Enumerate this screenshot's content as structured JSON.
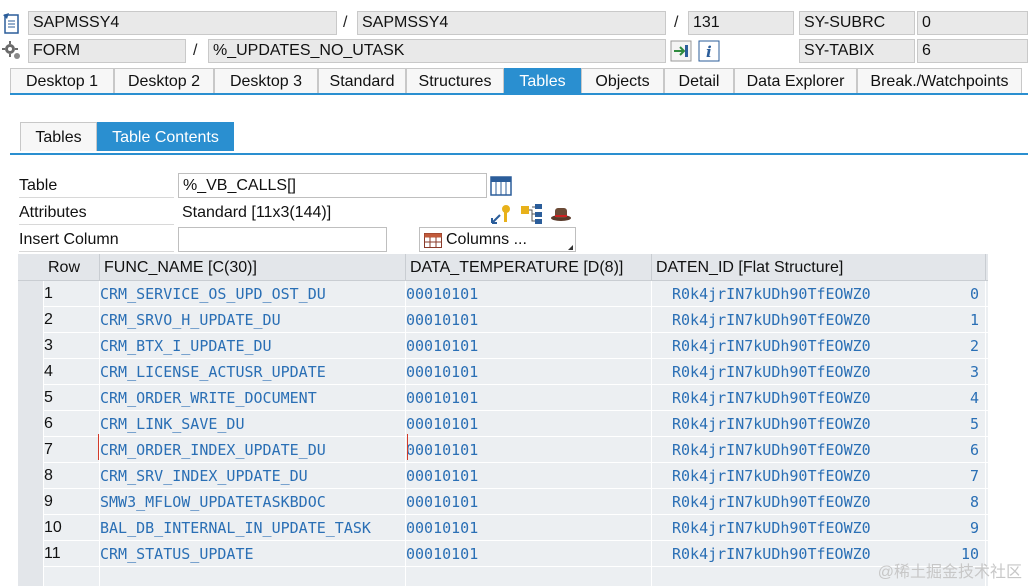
{
  "header": {
    "program_1": "SAPMSSY4",
    "sep_1": "/",
    "program_2": "SAPMSSY4",
    "sep_2": "/",
    "line_no": "131",
    "sy_subrc_label": "SY-SUBRC",
    "sy_subrc_value": "0",
    "event_type": "FORM",
    "sep_3": "/",
    "event_name": "%_UPDATES_NO_UTASK",
    "sy_tabix_label": "SY-TABIX",
    "sy_tabix_value": "6"
  },
  "tabs": [
    "Desktop 1",
    "Desktop 2",
    "Desktop 3",
    "Standard",
    "Structures",
    "Tables",
    "Objects",
    "Detail",
    "Data Explorer",
    "Break./Watchpoints"
  ],
  "active_tab": "Tables",
  "subtabs": [
    "Tables",
    "Table Contents"
  ],
  "active_subtab": "Table Contents",
  "form": {
    "table_label": "Table",
    "table_value": "%_VB_CALLS[]",
    "attributes_label": "Attributes",
    "attributes_value": "Standard [11x3(144)]",
    "insert_column_label": "Insert Column",
    "insert_column_value": "",
    "columns_button": "Columns ..."
  },
  "grid": {
    "headers": [
      "Row",
      "FUNC_NAME [C(30)]",
      "DATA_TEMPERATURE [D(8)]",
      "DATEN_ID [Flat Structure]"
    ],
    "rows": [
      {
        "row": "1",
        "func": "CRM_SERVICE_OS_UPD_OST_DU",
        "temp": "00010101",
        "id": "R0k4jrIN7kUDh90TfEOWZ0",
        "idx": "0"
      },
      {
        "row": "2",
        "func": "CRM_SRVO_H_UPDATE_DU",
        "temp": "00010101",
        "id": "R0k4jrIN7kUDh90TfEOWZ0",
        "idx": "1"
      },
      {
        "row": "3",
        "func": "CRM_BTX_I_UPDATE_DU",
        "temp": "00010101",
        "id": "R0k4jrIN7kUDh90TfEOWZ0",
        "idx": "2"
      },
      {
        "row": "4",
        "func": "CRM_LICENSE_ACTUSR_UPDATE",
        "temp": "00010101",
        "id": "R0k4jrIN7kUDh90TfEOWZ0",
        "idx": "3"
      },
      {
        "row": "5",
        "func": "CRM_ORDER_WRITE_DOCUMENT",
        "temp": "00010101",
        "id": "R0k4jrIN7kUDh90TfEOWZ0",
        "idx": "4"
      },
      {
        "row": "6",
        "func": "CRM_LINK_SAVE_DU",
        "temp": "00010101",
        "id": "R0k4jrIN7kUDh90TfEOWZ0",
        "idx": "5"
      },
      {
        "row": "7",
        "func": "CRM_ORDER_INDEX_UPDATE_DU",
        "temp": "00010101",
        "id": "R0k4jrIN7kUDh90TfEOWZ0",
        "idx": "6"
      },
      {
        "row": "8",
        "func": "CRM_SRV_INDEX_UPDATE_DU",
        "temp": "00010101",
        "id": "R0k4jrIN7kUDh90TfEOWZ0",
        "idx": "7"
      },
      {
        "row": "9",
        "func": "SMW3_MFLOW_UPDATETASKBDOC",
        "temp": "00010101",
        "id": "R0k4jrIN7kUDh90TfEOWZ0",
        "idx": "8"
      },
      {
        "row": "10",
        "func": "BAL_DB_INTERNAL_IN_UPDATE_TASK",
        "temp": "00010101",
        "id": "R0k4jrIN7kUDh90TfEOWZ0",
        "idx": "9"
      },
      {
        "row": "11",
        "func": "CRM_STATUS_UPDATE",
        "temp": "00010101",
        "id": "R0k4jrIN7kUDh90TfEOWZ0",
        "idx": "10"
      }
    ]
  },
  "watermark": "@稀土掘金技术社区",
  "colors": {
    "accent": "#2a8fd0",
    "link_text": "#2a6fb5",
    "grid_bg": "#eceff2"
  },
  "icons": [
    "document-icon",
    "gear-icon",
    "navigate-icon",
    "info-icon",
    "table-view-icon",
    "keys-icon",
    "hierarchy-icon",
    "hat-icon",
    "columns-icon"
  ]
}
